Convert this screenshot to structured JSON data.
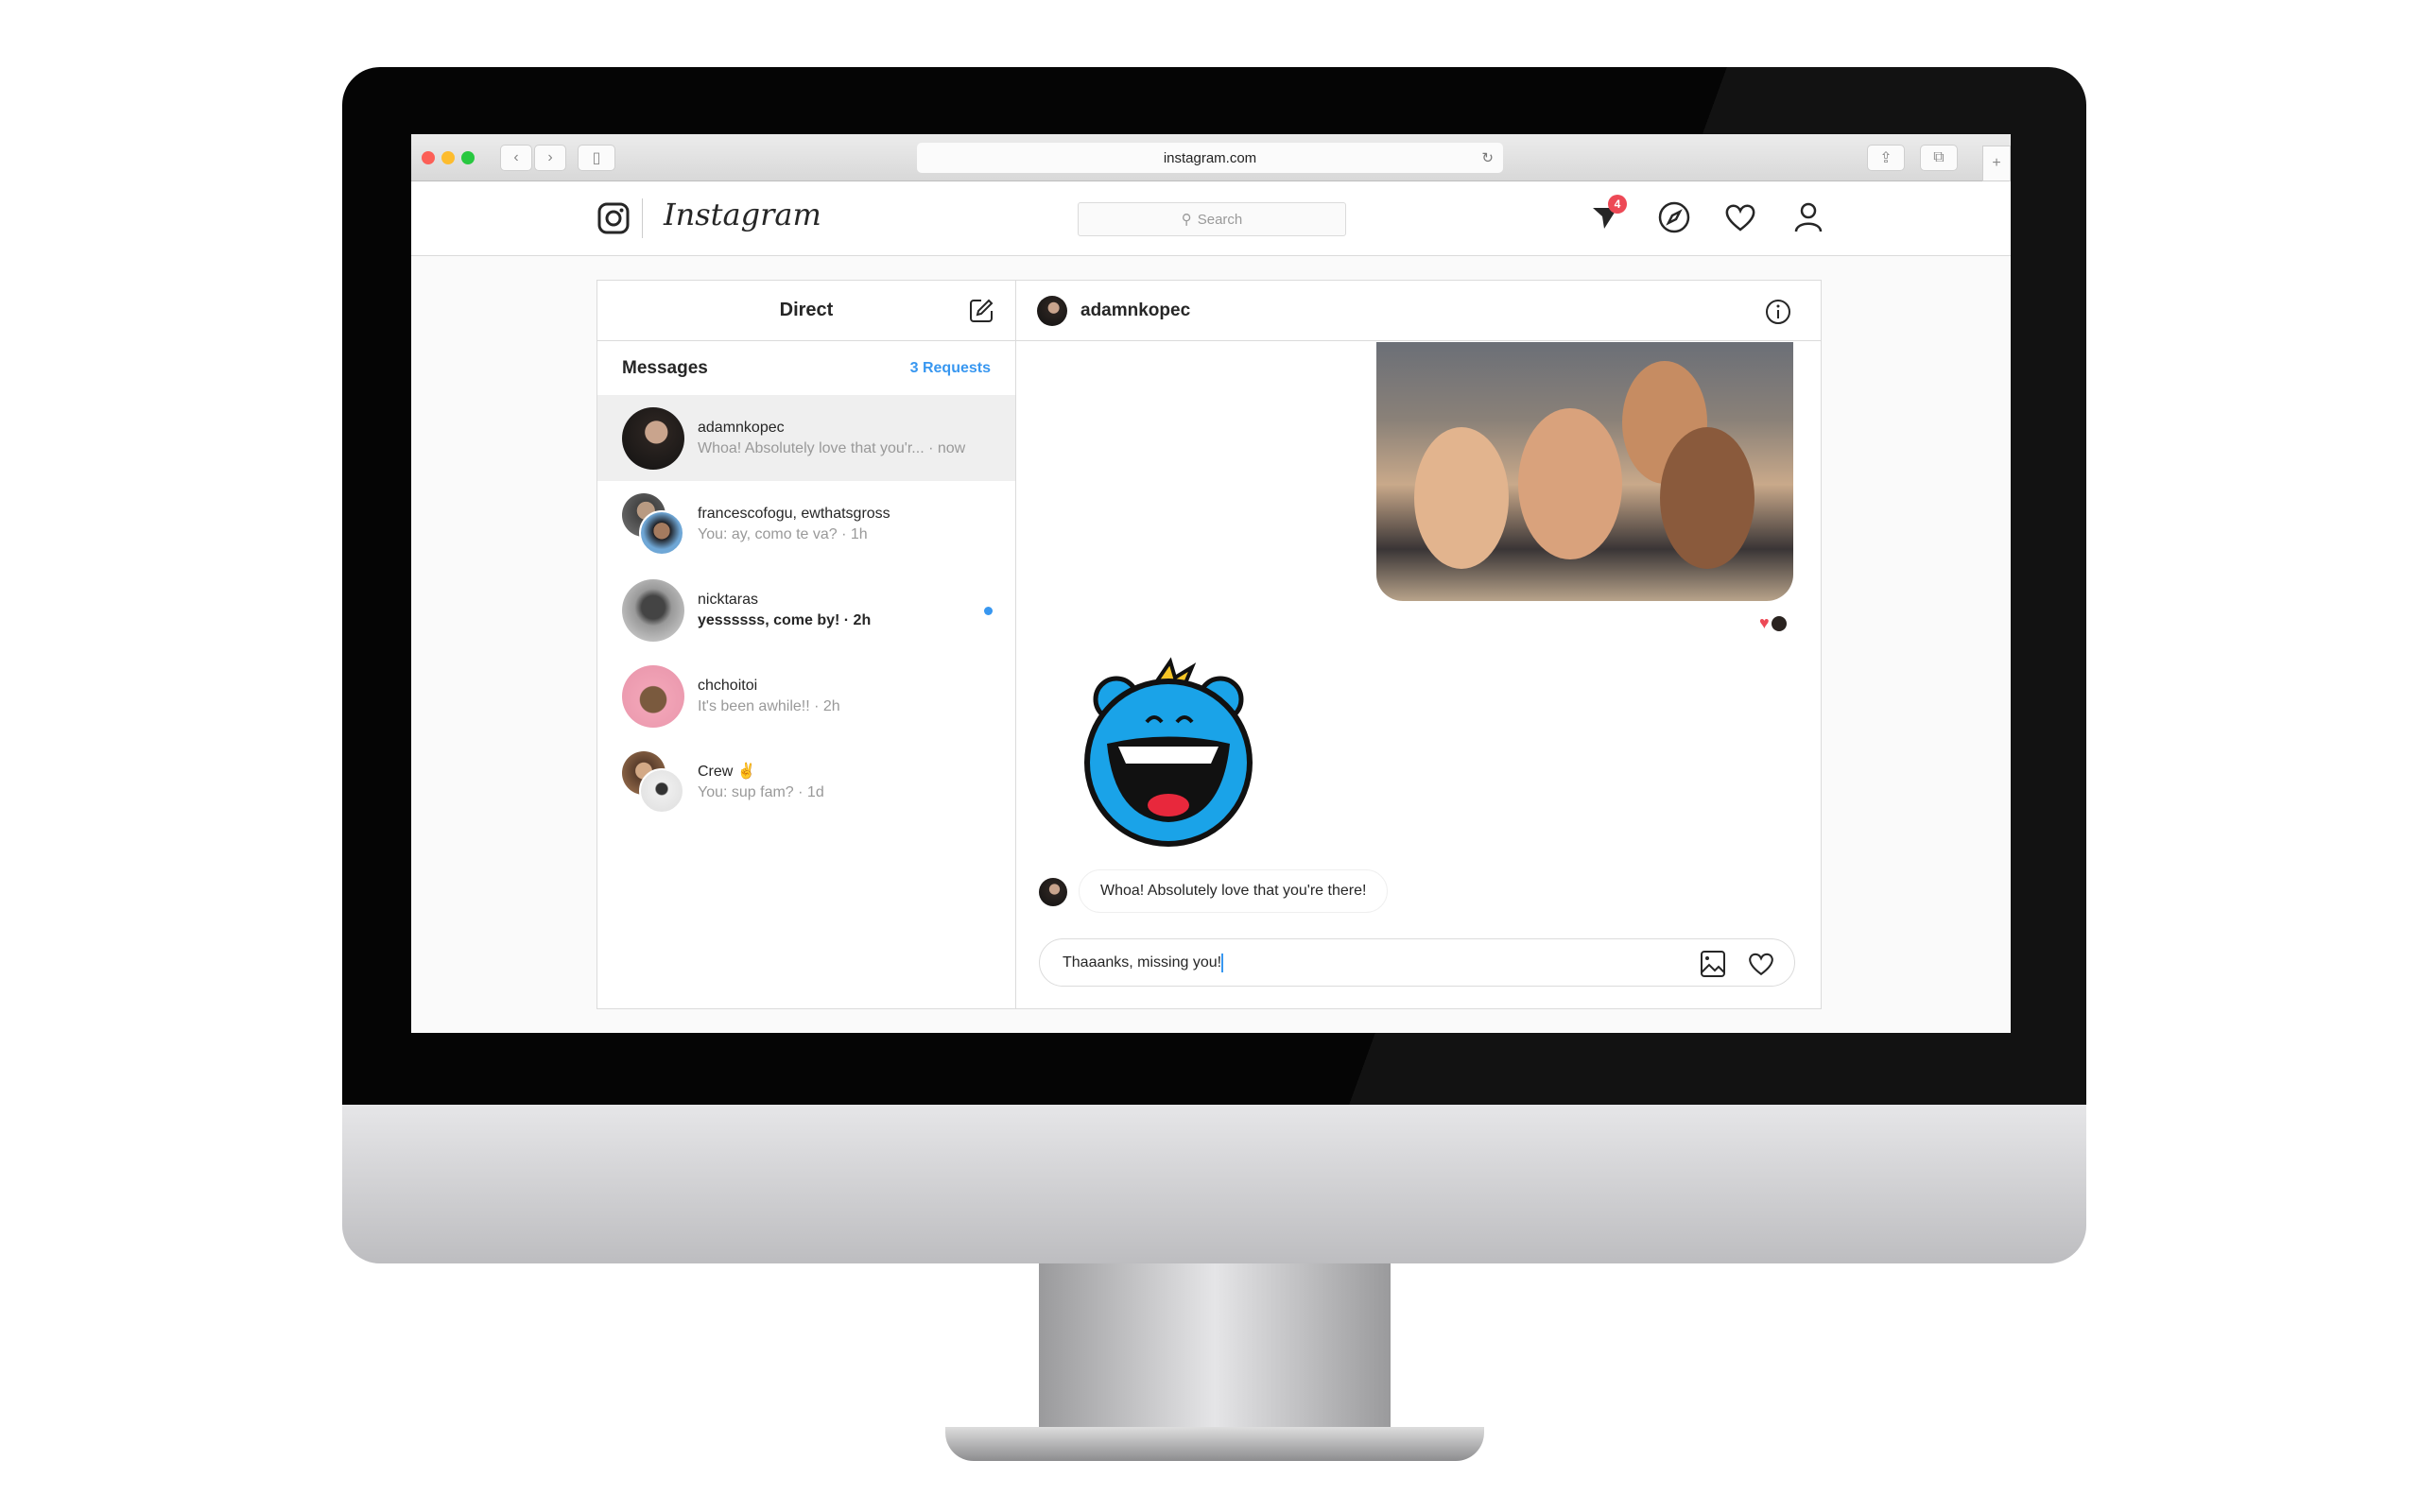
{
  "browser": {
    "url": "instagram.com"
  },
  "header": {
    "logo_text": "Instagram",
    "search_placeholder": "Search",
    "notification_count": "4"
  },
  "direct": {
    "title": "Direct",
    "messages_label": "Messages",
    "requests_label": "3 Requests",
    "conversations": [
      {
        "name": "adamnkopec",
        "preview": "Whoa! Absolutely love that you'r... · now",
        "selected": true,
        "unread": false
      },
      {
        "name": "francescofogu, ewthatsgross",
        "preview": "You: ay, como te va? · 1h",
        "selected": false,
        "unread": false
      },
      {
        "name": "nicktaras",
        "preview": "yessssss, come by! · 2h",
        "selected": false,
        "unread": true
      },
      {
        "name": "chchoitoi",
        "preview": "It's been awhile!! · 2h",
        "selected": false,
        "unread": false
      },
      {
        "name": "Crew ✌️",
        "preview": "You: sup fam? · 1d",
        "selected": false,
        "unread": false
      }
    ]
  },
  "chat": {
    "username": "adamnkopec",
    "received_message": "Whoa! Absolutely love that you're there!",
    "input_value": "Thaaanks, missing you!"
  },
  "colors": {
    "accent": "#3897f0",
    "badge": "#ed4956",
    "sticker": "#1aa3e8"
  }
}
